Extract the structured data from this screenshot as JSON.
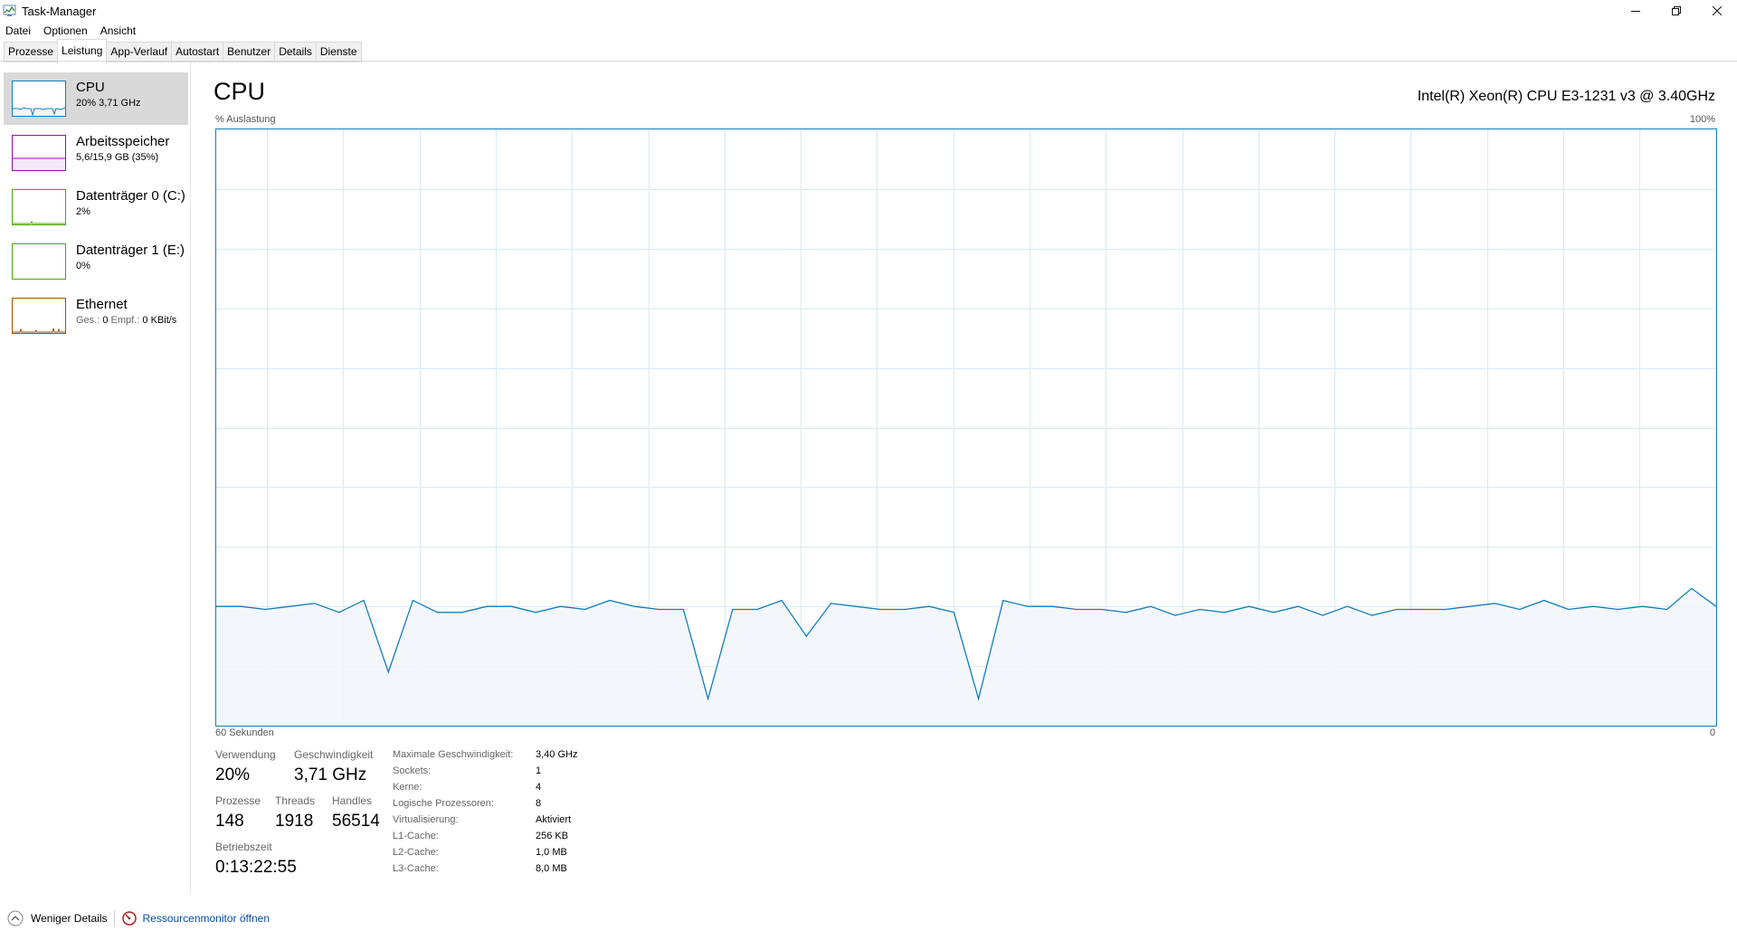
{
  "window": {
    "title": "Task-Manager"
  },
  "menu": [
    "Datei",
    "Optionen",
    "Ansicht"
  ],
  "tabs": [
    "Prozesse",
    "Leistung",
    "App-Verlauf",
    "Autostart",
    "Benutzer",
    "Details",
    "Dienste"
  ],
  "active_tab": "Leistung",
  "sidebar": [
    {
      "name": "CPU",
      "sub": "20% 3,71 GHz",
      "color": "#117dbb"
    },
    {
      "name": "Arbeitsspeicher",
      "sub": "5,6/15,9 GB (35%)",
      "color": "#8b12ae"
    },
    {
      "name": "Datenträger 0 (C:)",
      "sub": "2%",
      "color": "#4da60c"
    },
    {
      "name": "Datenträger 1 (E:)",
      "sub": "0%",
      "color": "#4da60c"
    },
    {
      "name": "Ethernet",
      "sub_label_1": "Ges.:",
      "sub_value_1": "0",
      "sub_label_2": "Empf.:",
      "sub_value_2": "0 KBit/s",
      "color": "#a74f01"
    }
  ],
  "main": {
    "title": "CPU",
    "cpu_model": "Intel(R) Xeon(R) CPU E3-1231 v3 @ 3.40GHz",
    "y_label": "% Auslastung",
    "y_max_label": "100%",
    "x_left_label": "60 Sekunden",
    "x_right_label": "0"
  },
  "chart_data": {
    "type": "area",
    "ylim": [
      0,
      100
    ],
    "xlim": [
      60,
      0
    ],
    "color": "#117dbb",
    "fill": "#f1f6fa",
    "values": [
      20,
      20,
      19.5,
      20,
      20.5,
      19,
      21,
      9,
      21,
      19,
      19,
      20,
      20,
      19,
      20,
      19.5,
      21,
      20,
      19.5,
      19.5,
      4.5,
      19.5,
      19.5,
      21,
      15,
      20.5,
      20,
      19.5,
      19.5,
      20,
      19,
      4.5,
      21,
      20,
      20,
      19.5,
      19.5,
      19,
      20,
      18.5,
      19.5,
      19,
      20,
      19,
      20,
      18.5,
      20,
      18.5,
      19.5,
      19.5,
      19.5,
      20,
      20.5,
      19.5,
      21,
      19.5,
      20,
      19.5,
      20,
      19.5,
      23,
      20
    ]
  },
  "stats": {
    "verwendung_label": "Verwendung",
    "verwendung": "20%",
    "geschwindigkeit_label": "Geschwindigkeit",
    "geschwindigkeit": "3,71 GHz",
    "prozesse_label": "Prozesse",
    "prozesse": "148",
    "threads_label": "Threads",
    "threads": "1918",
    "handles_label": "Handles",
    "handles": "56514",
    "betriebszeit_label": "Betriebszeit",
    "betriebszeit": "0:13:22:55"
  },
  "details": [
    {
      "label": "Maximale Geschwindigkeit:",
      "value": "3,40 GHz"
    },
    {
      "label": "Sockets:",
      "value": "1"
    },
    {
      "label": "Kerne:",
      "value": "4"
    },
    {
      "label": "Logische Prozessoren:",
      "value": "8"
    },
    {
      "label": "Virtualisierung:",
      "value": "Aktiviert"
    },
    {
      "label": "L1-Cache:",
      "value": "256 KB"
    },
    {
      "label": "L2-Cache:",
      "value": "1,0 MB"
    },
    {
      "label": "L3-Cache:",
      "value": "8,0 MB"
    }
  ],
  "footer": {
    "fewer_details": "Weniger Details",
    "resource_monitor": "Ressourcenmonitor öffnen"
  }
}
